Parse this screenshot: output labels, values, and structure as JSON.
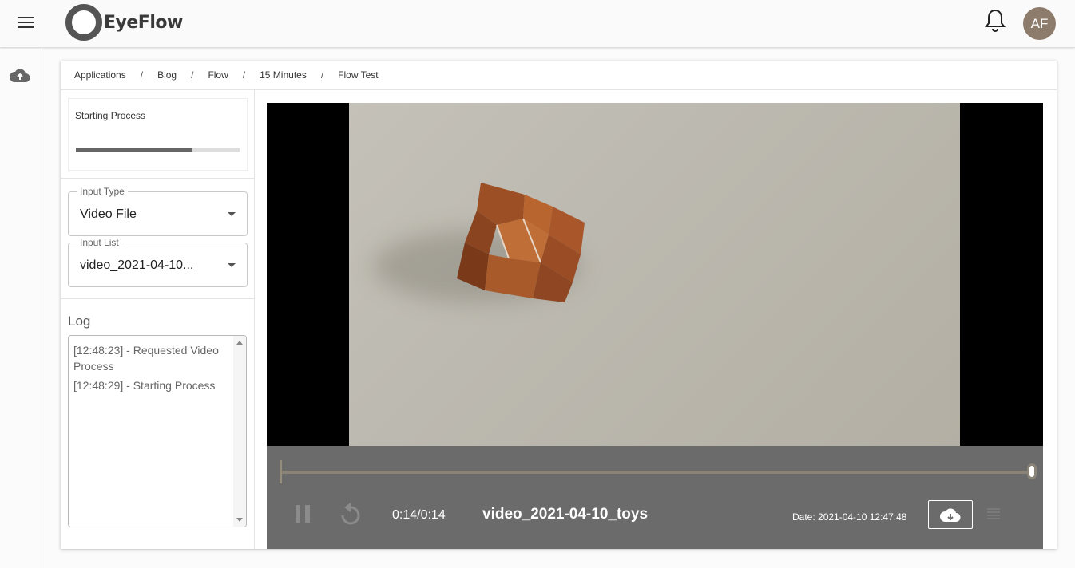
{
  "app": {
    "name": "EyeFlow",
    "avatar_initials": "AF"
  },
  "icons": {
    "menu": "menu-icon",
    "notifications": "bell-icon",
    "upload": "cloud-upload-icon",
    "pause": "pause-icon",
    "replay": "replay-icon",
    "download": "cloud-download-icon",
    "list": "list-icon"
  },
  "breadcrumb": [
    "Applications",
    "Blog",
    "Flow",
    "15 Minutes",
    "Flow Test"
  ],
  "status": {
    "label": "Starting Process",
    "progress_fraction": 0.71
  },
  "input_type": {
    "label": "Input Type",
    "value": "Video File"
  },
  "input_list": {
    "label": "Input List",
    "value": "video_2021-04-10..."
  },
  "log": {
    "title": "Log",
    "lines": [
      "[12:48:23] - Requested Video Process",
      "[12:48:29] - Starting Process"
    ]
  },
  "player": {
    "time": "0:14/0:14",
    "title": "video_2021-04-10_toys",
    "date": "Date: 2021-04-10 12:47:48",
    "position_fraction": 1.0
  },
  "colors": {
    "accent": "#6b6b6b",
    "avatar": "#8d7b6c",
    "toy": "#a8562a"
  }
}
